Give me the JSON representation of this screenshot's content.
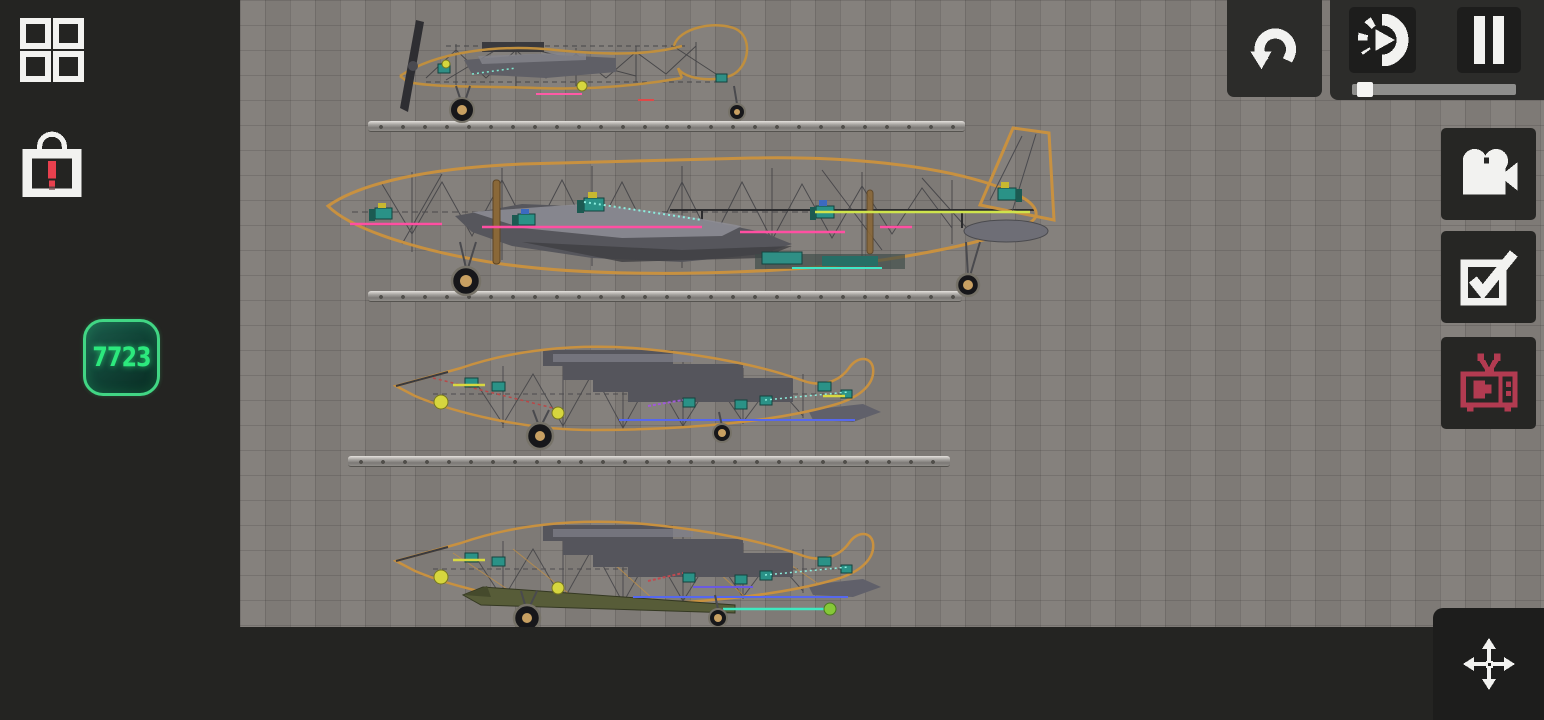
{
  "app": {
    "name": "sandbox-physics-game",
    "scene": "airplane-builds-on-grid"
  },
  "hud": {
    "left_toolbar": {
      "menu_button": {
        "icon": "grid-menu-icon"
      },
      "lock_button": {
        "icon": "lock-alert-icon",
        "alert_color": "#e8404e"
      },
      "counter_badge": {
        "value": "7723",
        "text_color": "#2ce97d",
        "border_color": "#41d684"
      }
    },
    "top_right": {
      "undo_button": {
        "icon": "undo-arrow-icon"
      },
      "sim_controls": {
        "speed_button": {
          "icon": "sim-speed-icon"
        },
        "pause_button": {
          "icon": "pause-icon"
        },
        "speed_slider": {
          "value_percent": 4
        }
      }
    },
    "right_toolbar": {
      "record_button": {
        "icon": "video-camera-icon"
      },
      "tasks_button": {
        "icon": "checkbox-check-icon"
      },
      "tv_button": {
        "icon": "tv-icon",
        "color": "#b23b51"
      }
    },
    "bottom_right": {
      "move_tool_button": {
        "icon": "move-arrows-icon"
      }
    }
  },
  "canvas": {
    "background_color": "#827e7a",
    "grid_size_px": 25,
    "wireframe_color": "#c89140",
    "planes": [
      {
        "id": "plane-1",
        "description": "small propeller aircraft wireframe on dolly rail"
      },
      {
        "id": "plane-2",
        "description": "large transport aircraft wireframe with tall tail fin"
      },
      {
        "id": "plane-3",
        "description": "jet aircraft wireframe on dolly rail"
      },
      {
        "id": "plane-4",
        "description": "jet aircraft wireframe with underslung olive boom"
      }
    ],
    "platform_count": 3
  }
}
